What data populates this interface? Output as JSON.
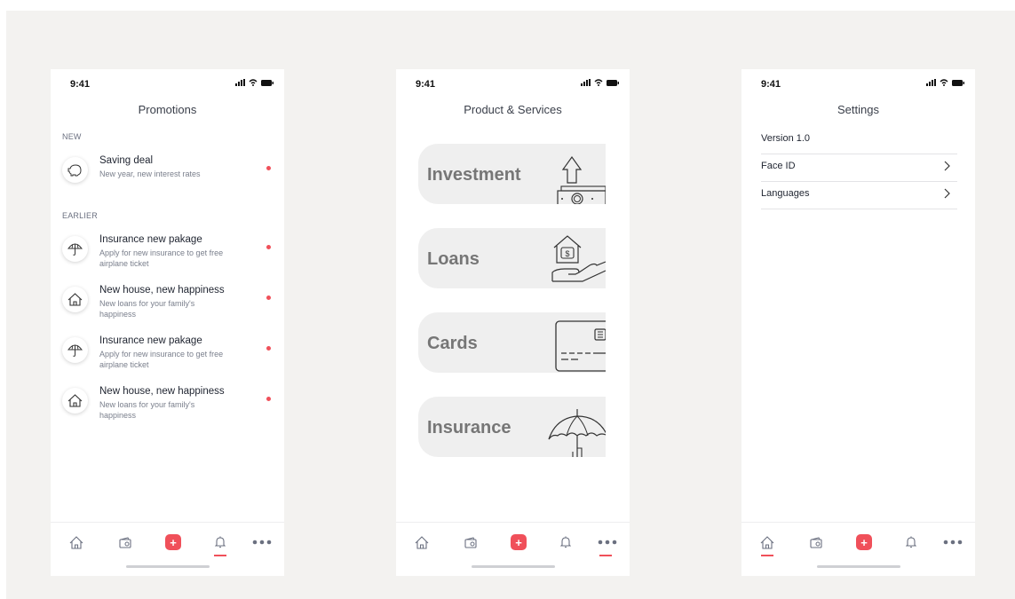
{
  "status_time": "9:41",
  "colors": {
    "accent": "#f0505a",
    "background": "#f3f2f0"
  },
  "promotions": {
    "title": "Promotions",
    "new_label": "NEW",
    "earlier_label": "EARLIER",
    "new_items": [
      {
        "title": "Saving deal",
        "desc": "New year, new interest rates",
        "icon": "piggy-bank-icon"
      }
    ],
    "earlier_items": [
      {
        "title": "Insurance new pakage",
        "desc": "Apply for new insurance to get free airplane ticket",
        "icon": "umbrella-icon"
      },
      {
        "title": "New house, new happiness",
        "desc": "New loans for your family's happiness",
        "icon": "house-icon"
      },
      {
        "title": "Insurance new pakage",
        "desc": "Apply for new insurance to get free airplane ticket",
        "icon": "umbrella-icon"
      },
      {
        "title": "New house, new happiness",
        "desc": "New loans for your family's happiness",
        "icon": "house-icon"
      }
    ]
  },
  "products": {
    "title": "Product & Services",
    "cards": [
      {
        "label": "Investment",
        "icon": "investment-icon"
      },
      {
        "label": "Loans",
        "icon": "loan-hand-icon"
      },
      {
        "label": "Cards",
        "icon": "credit-card-icon"
      },
      {
        "label": "Insurance",
        "icon": "umbrella-icon"
      }
    ]
  },
  "settings": {
    "title": "Settings",
    "rows": [
      {
        "label": "Version 1.0",
        "has_chevron": false
      },
      {
        "label": "Face ID",
        "has_chevron": true
      },
      {
        "label": "Languages",
        "has_chevron": true
      }
    ]
  },
  "tabbar": {
    "tabs": [
      "home-icon",
      "wallet-icon",
      "plus-icon",
      "bell-icon",
      "more-icon"
    ],
    "plus_symbol": "+",
    "active": {
      "promotions": 3,
      "products": 4,
      "settings": 0
    }
  }
}
